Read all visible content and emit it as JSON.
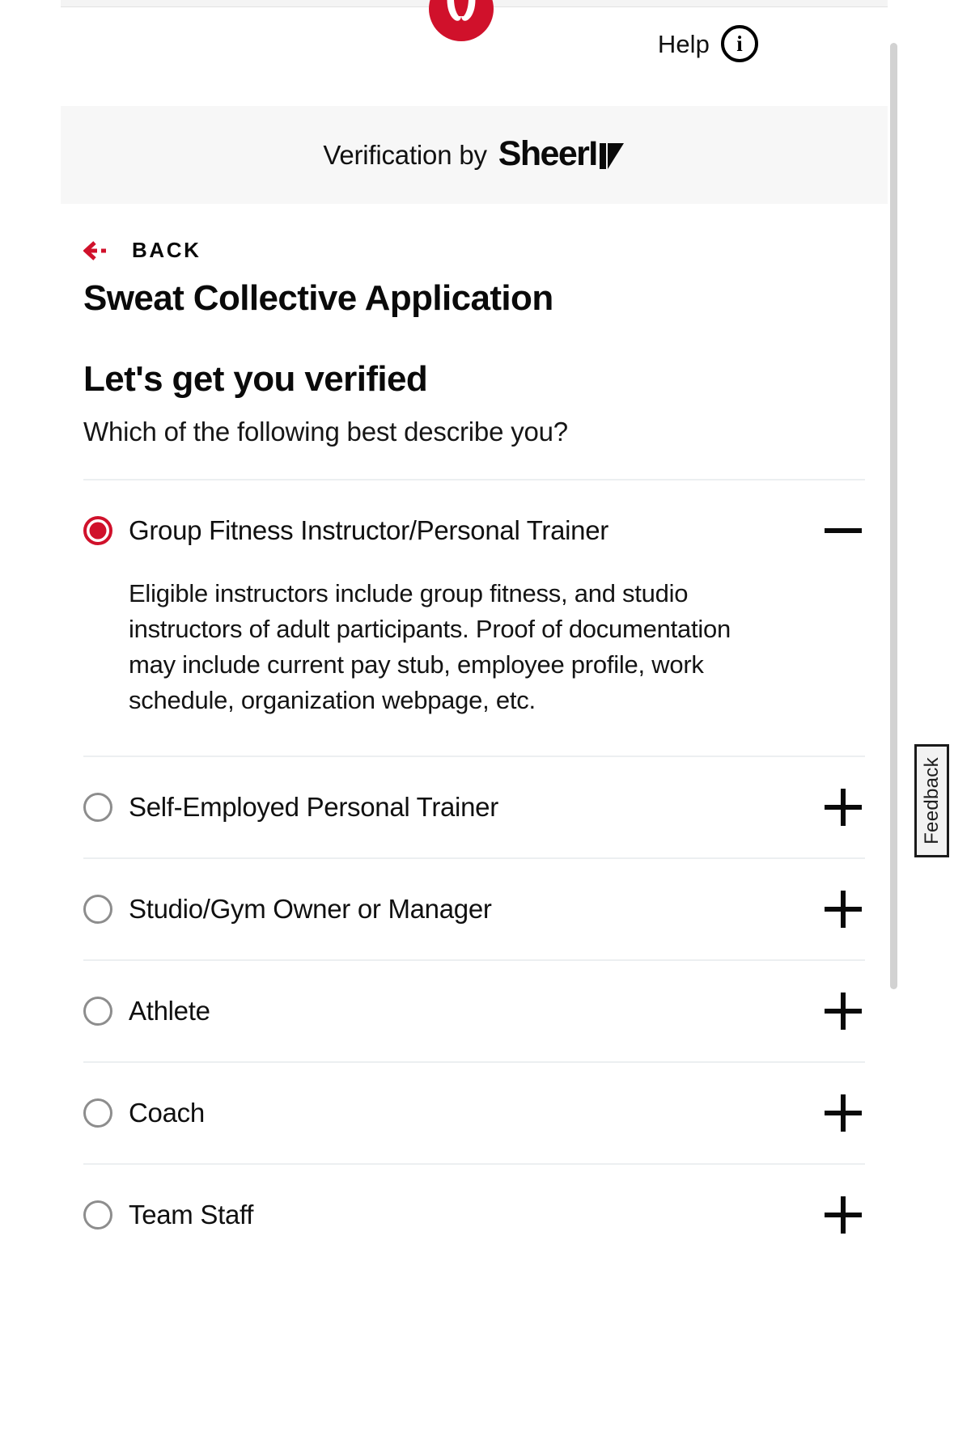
{
  "header": {
    "brand_logo_name": "lululemon-logo",
    "brand_color": "#d0112b",
    "help_label": "Help",
    "help_icon_glyph": "i"
  },
  "verification_band": {
    "prefix_text": "Verification by",
    "logo_word": "SheerID",
    "logo_word_visible": "SheerI",
    "logo_mark_name": "sheerid-d-mark"
  },
  "nav": {
    "back_label": "BACK",
    "back_arrow_color": "#d0112b"
  },
  "page": {
    "application_title": "Sweat Collective Application",
    "heading": "Let's get you verified",
    "question": "Which of the following best describe you?"
  },
  "options": [
    {
      "label": "Group Fitness Instructor/Personal Trainer",
      "selected": true,
      "expanded": true,
      "toggle_glyph": "minus",
      "description": "Eligible instructors include group fitness, and studio instructors of adult participants. Proof of documentation may include current pay stub, employee profile, work schedule, organization webpage, etc."
    },
    {
      "label": "Self-Employed Personal Trainer",
      "selected": false,
      "expanded": false,
      "toggle_glyph": "plus",
      "description": ""
    },
    {
      "label": "Studio/Gym Owner or Manager",
      "selected": false,
      "expanded": false,
      "toggle_glyph": "plus",
      "description": ""
    },
    {
      "label": "Athlete",
      "selected": false,
      "expanded": false,
      "toggle_glyph": "plus",
      "description": ""
    },
    {
      "label": "Coach",
      "selected": false,
      "expanded": false,
      "toggle_glyph": "plus",
      "description": ""
    },
    {
      "label": "Team Staff",
      "selected": false,
      "expanded": false,
      "toggle_glyph": "plus",
      "description": ""
    }
  ],
  "feedback": {
    "label": "Feedback"
  }
}
